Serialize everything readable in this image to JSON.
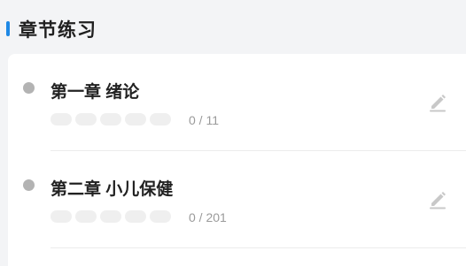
{
  "section": {
    "title": "章节练习"
  },
  "chapters": [
    {
      "title": "第一章 绪论",
      "progress": "0 / 11",
      "completed": 0,
      "total": 11,
      "icon": "edit-icon"
    },
    {
      "title": "第二章 小儿保健",
      "progress": "0 / 201",
      "completed": 0,
      "total": 201,
      "icon": "edit-icon"
    }
  ],
  "colors": {
    "accent": "#1e88e5",
    "bullet": "#b3b3b3",
    "icon": "#c8c8c8"
  }
}
